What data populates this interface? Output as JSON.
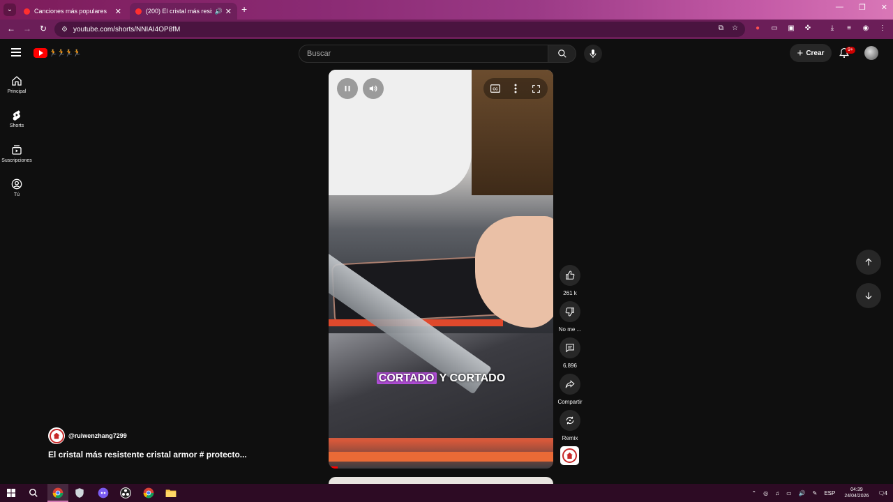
{
  "browser": {
    "tabs": [
      {
        "title": "Canciones más populares",
        "active": false
      },
      {
        "title": "(200) El cristal más resistente",
        "active": true
      }
    ],
    "url": "youtube.com/shorts/NNIAI4OP8fM"
  },
  "youtube": {
    "search_placeholder": "Buscar",
    "create_label": "Crear",
    "notification_count": "9+",
    "sidebar": [
      {
        "label": "Principal",
        "icon": "home-icon"
      },
      {
        "label": "Shorts",
        "icon": "shorts-icon"
      },
      {
        "label": "Suscripciones",
        "icon": "subscriptions-icon"
      },
      {
        "label": "Tú",
        "icon": "you-icon"
      }
    ],
    "short": {
      "caption_highlight": "CORTADO",
      "caption_rest": "Y CORTADO",
      "channel": "@ruiwenzhang7299",
      "title": "El cristal más resistente cristal armor # protecto...",
      "progress": 0.04
    },
    "actions": {
      "likes": "261 k",
      "dislike_label": "No me ...",
      "comments": "6,896",
      "share_label": "Compartir",
      "remix_label": "Remix"
    }
  },
  "taskbar": {
    "language": "ESP",
    "time": "04:39",
    "date": "24/04/2026",
    "notification_count": "4"
  }
}
